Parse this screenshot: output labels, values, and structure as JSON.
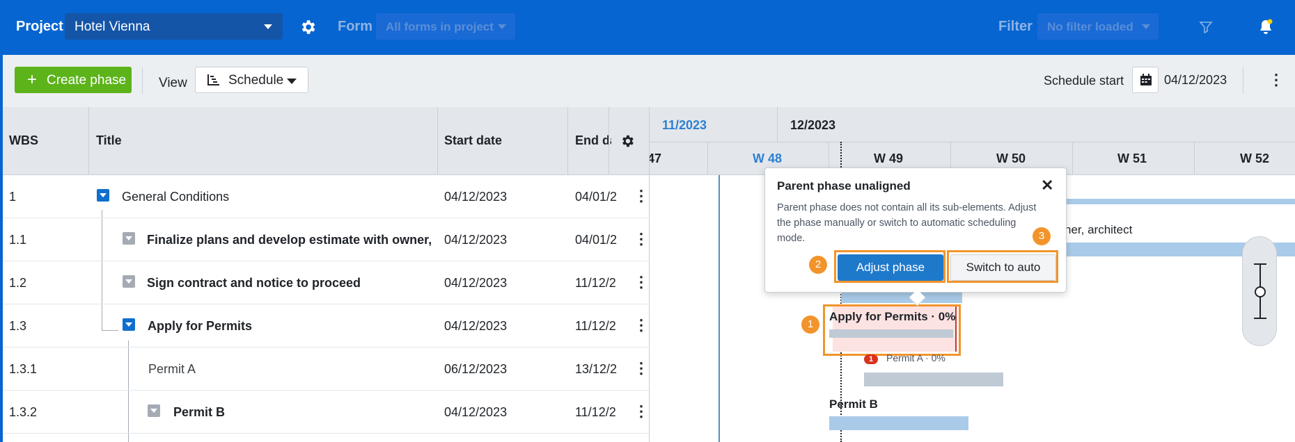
{
  "topbar": {
    "project_label": "Project",
    "project_value": "Hotel Vienna",
    "form_label": "Form",
    "form_value": "All forms in project",
    "filter_label": "Filter",
    "filter_value": "No filter loaded",
    "icons": [
      "gear-icon",
      "filter-icon",
      "bell-icon"
    ],
    "colors": {
      "bar": "#0665d0",
      "notification_dot": "#f5d000"
    }
  },
  "toolbar": {
    "create_label": "Create phase",
    "view_label": "View",
    "view_value": "Schedule",
    "schedule_start_label": "Schedule start",
    "schedule_start_value": "04/12/2023",
    "colors": {
      "create_button": "#5cb31a"
    }
  },
  "table": {
    "columns": [
      "WBS",
      "Title",
      "Start date",
      "End da"
    ],
    "rows": [
      {
        "wbs": "1",
        "title": "General Conditions",
        "start": "04/12/2023",
        "end": "04/01/2"
      },
      {
        "wbs": "1.1",
        "title": "Finalize plans and develop estimate with owner, arc...",
        "start": "04/12/2023",
        "end": "04/01/2"
      },
      {
        "wbs": "1.2",
        "title": "Sign contract and notice to proceed",
        "start": "04/12/2023",
        "end": "11/12/2"
      },
      {
        "wbs": "1.3",
        "title": "Apply for Permits",
        "start": "04/12/2023",
        "end": "11/12/2"
      },
      {
        "wbs": "1.3.1",
        "title": "Permit A",
        "start": "06/12/2023",
        "end": "13/12/2"
      },
      {
        "wbs": "1.3.2",
        "title": "Permit B",
        "start": "04/12/2023",
        "end": "11/12/2"
      }
    ]
  },
  "gantt": {
    "months": [
      "11/2023",
      "12/2023"
    ],
    "weeks": [
      "47",
      "W 48",
      "W 49",
      "W 50",
      "W 51",
      "W 52"
    ],
    "bar_labels": {
      "finalize_partial": "ner, architect",
      "apply_permits": "Apply for Permits · 0%",
      "permit_a": "Permit A · 0%",
      "permit_a_badge": "1",
      "permit_b": "Permit B"
    },
    "markers": [
      "1",
      "2",
      "3"
    ],
    "colors": {
      "highlight": "#f2942b",
      "current_month": "#2f7fd1"
    }
  },
  "popup": {
    "title": "Parent phase unaligned",
    "body": "Parent phase does not contain all its sub-elements. Adjust the phase manually or switch to automatic scheduling mode.",
    "adjust_label": "Adjust phase",
    "auto_label": "Switch to auto"
  }
}
